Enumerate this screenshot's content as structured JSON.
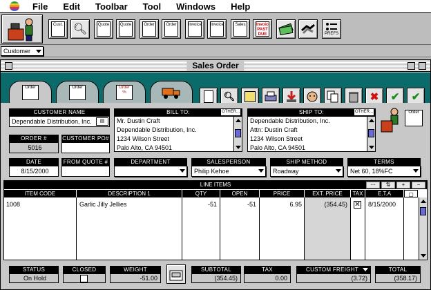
{
  "menubar": {
    "items": [
      "File",
      "Edit",
      "Toolbar",
      "Tool",
      "Windows",
      "Help"
    ]
  },
  "toolbar": {
    "buttons": [
      {
        "label": "Cust.",
        "icon": "customer-doc-icon"
      },
      {
        "label": "",
        "icon": "search-magnifier-icon"
      },
      {
        "label": "Quote",
        "icon": "quote-doc-icon"
      },
      {
        "label": "Quote",
        "icon": "quote-search-icon"
      },
      {
        "label": "Order",
        "icon": "order-doc-icon"
      },
      {
        "label": "Order",
        "icon": "order-search-icon"
      },
      {
        "label": "Invoice",
        "icon": "invoice-doc-icon"
      },
      {
        "label": "Invoice",
        "icon": "invoice-search-icon"
      },
      {
        "label": "Sales",
        "icon": "sales-doc-icon"
      },
      {
        "label": "Invoice PAST DUE",
        "icon": "past-due-icon"
      },
      {
        "label": "",
        "icon": "money-icon"
      },
      {
        "label": "",
        "icon": "handshake-icon"
      },
      {
        "label": "PREFS",
        "icon": "prefs-icon"
      }
    ]
  },
  "customer_selector": {
    "value": "Customer"
  },
  "window": {
    "title": "Sales Order",
    "tabs": [
      {
        "label": "Order",
        "icon": "order-tab-icon"
      },
      {
        "label": "Order",
        "icon": "new-order-tab-icon"
      },
      {
        "label": "Order %",
        "icon": "discount-tab-icon"
      },
      {
        "label": "",
        "icon": "shipping-truck-icon"
      }
    ],
    "actions": [
      {
        "icon": "doc-list-icon"
      },
      {
        "icon": "order-search-icon"
      },
      {
        "icon": "notes-icon"
      },
      {
        "icon": "print-icon"
      },
      {
        "icon": "import-icon"
      },
      {
        "icon": "contact-icon"
      },
      {
        "icon": "copy-icon"
      },
      {
        "icon": "trash-icon"
      },
      {
        "icon": "cancel-x-icon",
        "glyph": "✖"
      },
      {
        "icon": "approve-all-icon",
        "glyph": "✔"
      },
      {
        "icon": "approve-icon",
        "glyph": "✔"
      }
    ]
  },
  "form": {
    "customer_name_label": "CUSTOMER NAME",
    "customer_name": "Dependable Distribution, Inc.",
    "order_no_label": "ORDER #",
    "order_no": "5016",
    "customer_po_label": "CUSTOMER PO#",
    "customer_po": "",
    "bill_to_label": "BILL TO:",
    "bill_to": [
      "Mr. Dustin Craft",
      "Dependable Distribution, Inc.",
      "1234 Wilson Street",
      "Palo Alto, CA  94501"
    ],
    "ship_to_label": "SHIP TO:",
    "ship_to": [
      "Dependable Distribution, Inc.",
      "Attn: Dustin Craft",
      "1234 Wilson Street",
      "Palo Alto, CA  94501"
    ],
    "other_label": "OTHER...",
    "date_label": "DATE",
    "date": "8/15/2000",
    "from_quote_label": "FROM QUOTE #",
    "from_quote": "",
    "department_label": "DEPARTMENT",
    "department": "",
    "salesperson_label": "SALESPERSON",
    "salesperson": "Philip Kehoe",
    "ship_method_label": "SHIP METHOD",
    "ship_method": "Roadway",
    "terms_label": "TERMS",
    "terms": "Net 60, 18%FC"
  },
  "line_items": {
    "title": "LINE ITEMS",
    "columns": [
      "ITEM CODE",
      "DESCRIPTION 1",
      "QTY",
      "OPEN",
      "PRICE",
      "EXT. PRICE",
      "TAX",
      "E.T.A"
    ],
    "rows": [
      {
        "item_code": "1008",
        "description": "Garlic Jilly Jellies",
        "qty": "-51",
        "open": "-51",
        "price": "6.95",
        "ext_price": "(354.45)",
        "tax": true,
        "eta": "8/15/2000"
      }
    ]
  },
  "footer": {
    "status_label": "STATUS",
    "status": "On Hold",
    "closed_label": "CLOSED",
    "weight_label": "WEIGHT",
    "weight": "-51.00",
    "subtotal_label": "SUBTOTAL",
    "subtotal": "(354.45)",
    "tax_label": "TAX",
    "tax": "0.00",
    "freight_label": "CUSTOM FREIGHT",
    "freight": "(3.72)",
    "total_label": "TOTAL",
    "total": "(358.17)"
  }
}
